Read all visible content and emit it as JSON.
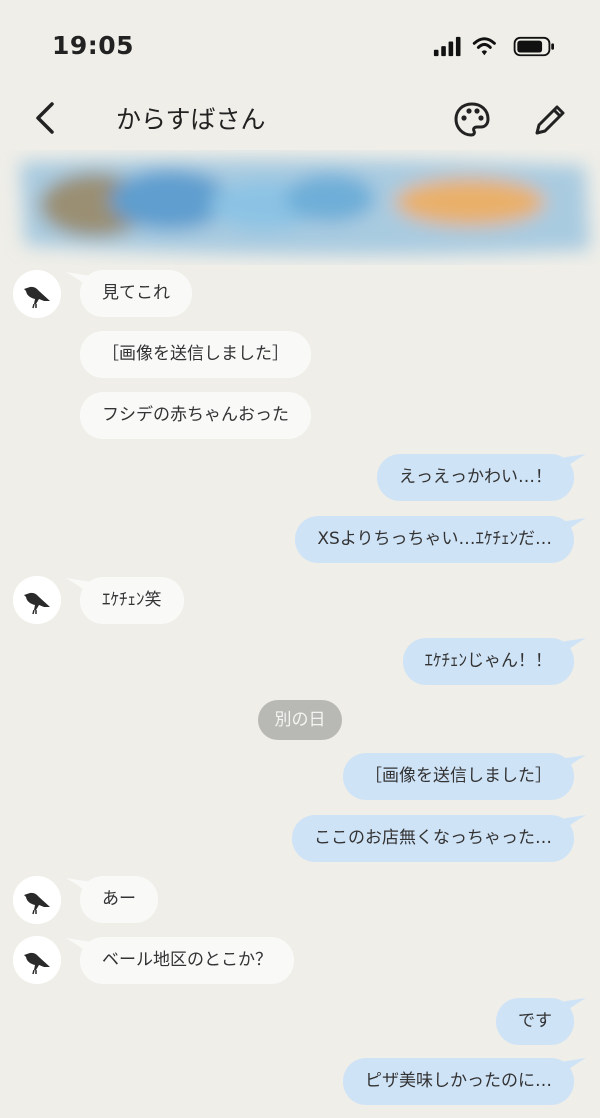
{
  "status": {
    "time": "19:05"
  },
  "header": {
    "title": "からすばさん"
  },
  "date_chip": "別の日",
  "messages": [
    {
      "side": "left",
      "text": "見てこれ"
    },
    {
      "side": "left",
      "text": "［画像を送信しました］"
    },
    {
      "side": "left",
      "text": "フシデの赤ちゃんおった"
    },
    {
      "side": "right",
      "text": "えっえっかわい…！"
    },
    {
      "side": "right",
      "text": "XSよりちっちゃい…ｴｹﾁｪﾝだ…"
    },
    {
      "side": "left",
      "text": "ｴｹﾁｪﾝ笑"
    },
    {
      "side": "right",
      "text": "ｴｹﾁｪﾝじゃん！！"
    },
    {
      "side": "right",
      "text": "［画像を送信しました］"
    },
    {
      "side": "right",
      "text": "ここのお店無くなっちゃった…"
    },
    {
      "side": "left",
      "text": "あー"
    },
    {
      "side": "left",
      "text": "ベール地区のとこか？"
    },
    {
      "side": "right",
      "text": "です"
    },
    {
      "side": "right",
      "text": "ピザ美味しかったのに…"
    }
  ],
  "colors": {
    "background": "#efeee8",
    "incoming": "#f9f9f8",
    "outgoing": "#cfe3f7",
    "date_chip": "#b8b8b4"
  }
}
